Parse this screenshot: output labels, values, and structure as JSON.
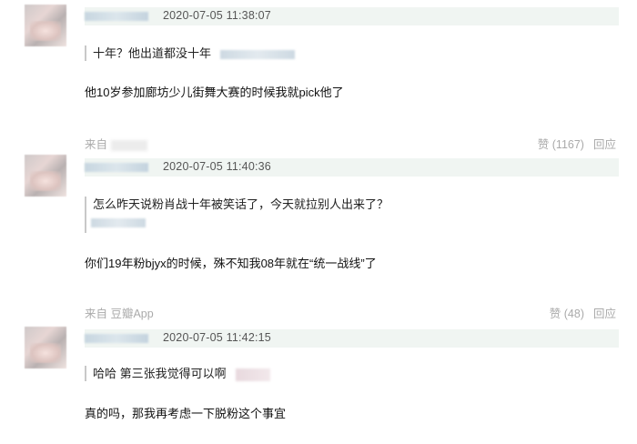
{
  "comments": [
    {
      "timestamp": "2020-07-05 11:38:07",
      "quote": "十年？他出道都没十年",
      "body": "他10岁参加廊坊少儿街舞大赛的时候我就pick他了",
      "source": "来自",
      "like_label": "赞 (1167)",
      "reply_label": "回应"
    },
    {
      "timestamp": "2020-07-05 11:40:36",
      "quote": "怎么昨天说粉肖战十年被笑话了，今天就拉别人出来了？",
      "body": "你们19年粉bjyx的时候，殊不知我08年就在“统一战线”了",
      "source": "来自 豆瓣App",
      "like_label": "赞 (48)",
      "reply_label": "回应"
    },
    {
      "timestamp": "2020-07-05 11:42:15",
      "quote": "哈哈 第三张我觉得可以啊",
      "body": "真的吗，那我再考虑一下脱粉这个事宜"
    }
  ]
}
